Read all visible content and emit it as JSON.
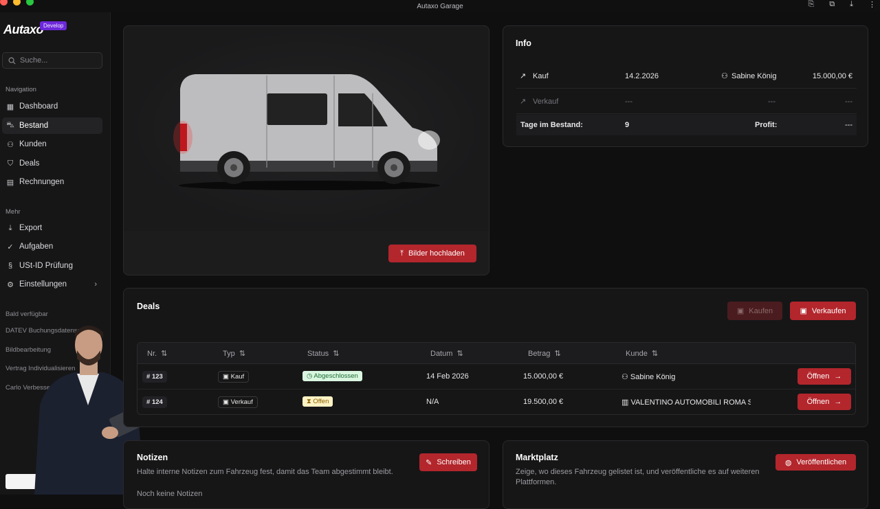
{
  "window": {
    "title": "Autaxo Garage"
  },
  "sidebar": {
    "logo": "Autaxo",
    "env_badge": "Develop",
    "search_placeholder": "Suche...",
    "nav_heading": "Navigation",
    "nav_items": [
      {
        "label": "Dashboard",
        "icon": "grid-icon"
      },
      {
        "label": "Bestand",
        "icon": "car-icon"
      },
      {
        "label": "Kunden",
        "icon": "users-icon"
      },
      {
        "label": "Deals",
        "icon": "handshake-icon"
      },
      {
        "label": "Rechnungen",
        "icon": "invoice-icon"
      }
    ],
    "more_heading": "Mehr",
    "more_items": [
      {
        "label": "Export",
        "icon": "download-icon"
      },
      {
        "label": "Aufgaben",
        "icon": "check-circle-icon"
      },
      {
        "label": "USt-ID Prüfung",
        "icon": "paragraph-icon"
      },
      {
        "label": "Einstellungen",
        "icon": "gear-icon"
      }
    ],
    "soon_heading": "Bald verfügbar",
    "soon_items": [
      "DATEV Buchungsdatensatz",
      "Bildbearbeitung",
      "Vertrag Individualisieren",
      "Carlo Verbesserungen"
    ]
  },
  "vehicle": {
    "upload_button": "Bilder hochladen"
  },
  "info": {
    "title": "Info",
    "purchase": {
      "label": "Kauf",
      "date": "14.2.2026",
      "person": "Sabine König",
      "amount": "15.000,00 €"
    },
    "sale": {
      "label": "Verkauf",
      "date": "---",
      "person": "---",
      "amount": "---"
    },
    "days_label": "Tage im Bestand:",
    "days_value": "9",
    "profit_label": "Profit:",
    "profit_value": "---"
  },
  "deals": {
    "title": "Deals",
    "buy_button": "Kaufen",
    "sell_button": "Verkaufen",
    "columns": [
      "Nr.",
      "Typ",
      "Status",
      "Datum",
      "Betrag",
      "Kunde"
    ],
    "rows": [
      {
        "nr": "123",
        "typ": "Kauf",
        "status": "Abgeschlossen",
        "datum": "14 Feb 2026",
        "betrag": "15.000,00 €",
        "kunde": "Sabine König",
        "action": "Öffnen"
      },
      {
        "nr": "124",
        "typ": "Verkauf",
        "status": "Offen",
        "datum": "N/A",
        "betrag": "19.500,00 €",
        "kunde": "VALENTINO AUTOMOBILI ROMA S",
        "action": "Öffnen"
      }
    ]
  },
  "notes": {
    "title": "Notizen",
    "description": "Halte interne Notizen zum Fahrzeug fest, damit das Team abgestimmt bleibt.",
    "button": "Schreiben",
    "empty": "Noch keine Notizen"
  },
  "market": {
    "title": "Marktplatz",
    "description": "Zeige, wo dieses Fahrzeug gelistet ist, und veröffentliche es auf weiteren Plattformen.",
    "button": "Veröffentlichen"
  },
  "colors": {
    "accent": "#b3262c",
    "background": "#0f0f10",
    "card": "#161617",
    "status_done": "#d9f6e0",
    "status_open": "#fdf2c4"
  }
}
